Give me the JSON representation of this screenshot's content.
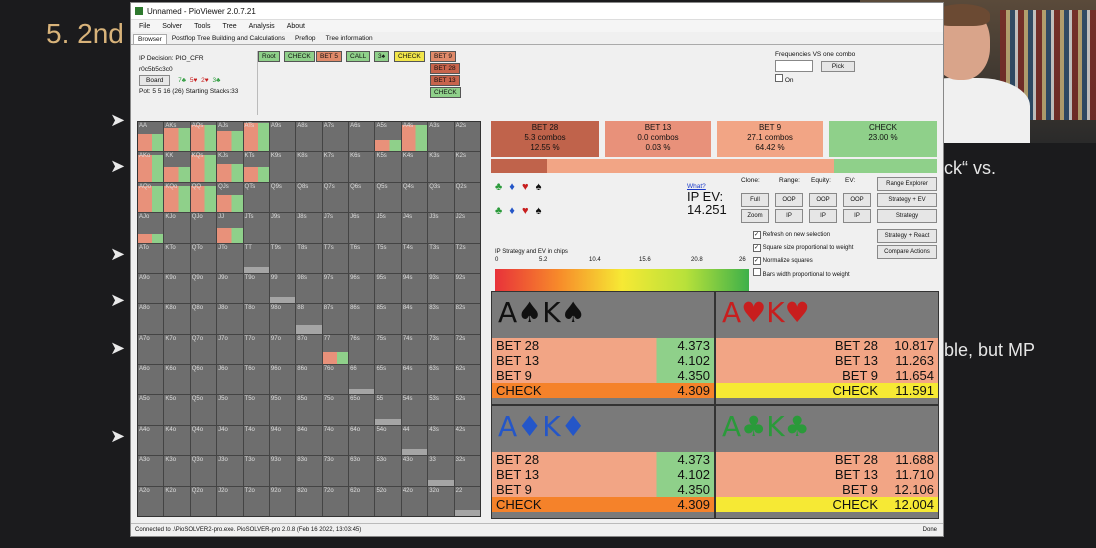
{
  "slide": {
    "title": "5. 2nd",
    "fragments": [
      "ck“ vs.",
      "ble, but MP"
    ]
  },
  "window": {
    "title": "Unnamed - PioViewer 2.0.7.21",
    "menu": [
      "File",
      "Solver",
      "Tools",
      "Tree",
      "Analysis",
      "About"
    ],
    "tabs": [
      "Browser",
      "Postflop Tree Building and Calculations",
      "Preflop",
      "Tree information"
    ],
    "ip_decision": "IP Decision: PIO_CFR",
    "board_cards": "r0c5b5c3c0",
    "board_button": "Board",
    "pot_info": "Pot: 5 5 16 (26) Starting Stacks:33",
    "action_buttons": [
      {
        "label": "Root",
        "color": "#8fd08a"
      },
      {
        "label": "CHECK",
        "color": "#8fd08a"
      },
      {
        "label": "BET 5",
        "color": "#e08a6a"
      },
      {
        "label": "CALL",
        "color": "#8fd08a"
      },
      {
        "label": "3♠",
        "color": "#8fd08a"
      },
      {
        "label": "CHECK",
        "color": "#f2e64a"
      },
      {
        "label": "BET 9",
        "color": "#e08a6a"
      },
      {
        "label": "BET 28",
        "color": "#c8644c"
      },
      {
        "label": "BET 13",
        "color": "#c8644c"
      },
      {
        "label": "CHECK",
        "color": "#8fd08a"
      }
    ],
    "freq_label": "Frequencies VS one combo",
    "pick_button": "Pick",
    "on_label": "On",
    "status_left": "Connected to .\\PioSOLVER2-pro.exe. PioSOLVER-pro 2.0.8 (Feb 16 2022, 13:03:45)",
    "status_right": "Done"
  },
  "strategy": [
    {
      "label": "BET 28",
      "combos": "5.3 combos",
      "pct": "12.55 %",
      "color": "#c0634b"
    },
    {
      "label": "BET 13",
      "combos": "0.0 combos",
      "pct": "0.03 %",
      "color": "#e8917a"
    },
    {
      "label": "BET 9",
      "combos": "27.1 combos",
      "pct": "64.42 %",
      "color": "#f2a585"
    },
    {
      "label": "CHECK",
      "combos": "",
      "pct": "23.00 %",
      "color": "#8fd08a"
    }
  ],
  "freq_fractions": [
    0.1255,
    0.0003,
    0.6442,
    0.23
  ],
  "ev": {
    "what": "What?",
    "label": "IP EV:",
    "value": "14.251",
    "scale_caption": "IP Strategy and EV in chips",
    "scale_ticks": [
      "0",
      "5.2",
      "10.4",
      "15.6",
      "20.8",
      "26"
    ]
  },
  "controls": {
    "headers": [
      "Clone:",
      "Range:",
      "Equity:",
      "EV:"
    ],
    "full": "Full",
    "zoom": "Zoom",
    "oop": "OOP",
    "ip": "IP",
    "right_buttons": [
      "Range Explorer",
      "Strategy + EV",
      "Strategy",
      "Strategy + React",
      "Compare Actions"
    ],
    "options": [
      {
        "label": "Refresh on new selection",
        "checked": true
      },
      {
        "label": "Square size proportional to weight",
        "checked": true
      },
      {
        "label": "Normalize squares",
        "checked": true
      },
      {
        "label": "Bars width proportional to weight",
        "checked": false
      }
    ]
  },
  "suit_rows": [
    [
      "♣",
      "♦",
      "♥",
      "♠"
    ],
    [
      "♣",
      "♦",
      "♥",
      "♠"
    ]
  ],
  "combos": [
    {
      "rank1": "A",
      "suit": "♠",
      "rank2": "K",
      "color": "#111",
      "rows": [
        {
          "name": "BET 28",
          "ev": "4.373"
        },
        {
          "name": "BET 13",
          "ev": "4.102"
        },
        {
          "name": "BET 9",
          "ev": "4.350"
        },
        {
          "name": "CHECK",
          "ev": "4.309"
        }
      ]
    },
    {
      "rank1": "A",
      "suit": "♥",
      "rank2": "K",
      "color": "#c81e1e",
      "rows": [
        {
          "name": "BET 28",
          "ev": "10.817"
        },
        {
          "name": "BET 13",
          "ev": "11.263"
        },
        {
          "name": "BET 9",
          "ev": "11.654"
        },
        {
          "name": "CHECK",
          "ev": "11.591"
        }
      ]
    },
    {
      "rank1": "A",
      "suit": "♦",
      "rank2": "K",
      "color": "#2456c8",
      "rows": [
        {
          "name": "BET 28",
          "ev": "4.373"
        },
        {
          "name": "BET 13",
          "ev": "4.102"
        },
        {
          "name": "BET 9",
          "ev": "4.350"
        },
        {
          "name": "CHECK",
          "ev": "4.309"
        }
      ]
    },
    {
      "rank1": "A",
      "suit": "♣",
      "rank2": "K",
      "color": "#2a9a3a",
      "rows": [
        {
          "name": "BET 28",
          "ev": "11.688"
        },
        {
          "name": "BET 13",
          "ev": "11.710"
        },
        {
          "name": "BET 9",
          "ev": "12.106"
        },
        {
          "name": "CHECK",
          "ev": "12.004"
        }
      ]
    }
  ],
  "ranks": [
    "A",
    "K",
    "Q",
    "J",
    "T",
    "9",
    "8",
    "7",
    "6",
    "5",
    "4",
    "3",
    "2"
  ],
  "hand_fills": {
    "AA": 0.6,
    "AKs": 0.8,
    "AQs": 0.9,
    "AJs": 0.7,
    "ATs": 0.95,
    "A5s": 0.4,
    "A4s": 0.9,
    "AKo": 0.9,
    "KK": 0.5,
    "KQs": 0.9,
    "KJs": 0.6,
    "KTs": 0.5,
    "AQo": 0.9,
    "KQo": 0.9,
    "QQ": 0.9,
    "QJs": 0.6,
    "JJ": 0.5,
    "AJo": 0.3,
    "TT": 0.2,
    "99": 0.2,
    "88": 0.3,
    "77": 0.4,
    "66": 0.2,
    "55": 0.2,
    "44": 0.2,
    "33": 0.2,
    "22": 0.2
  }
}
